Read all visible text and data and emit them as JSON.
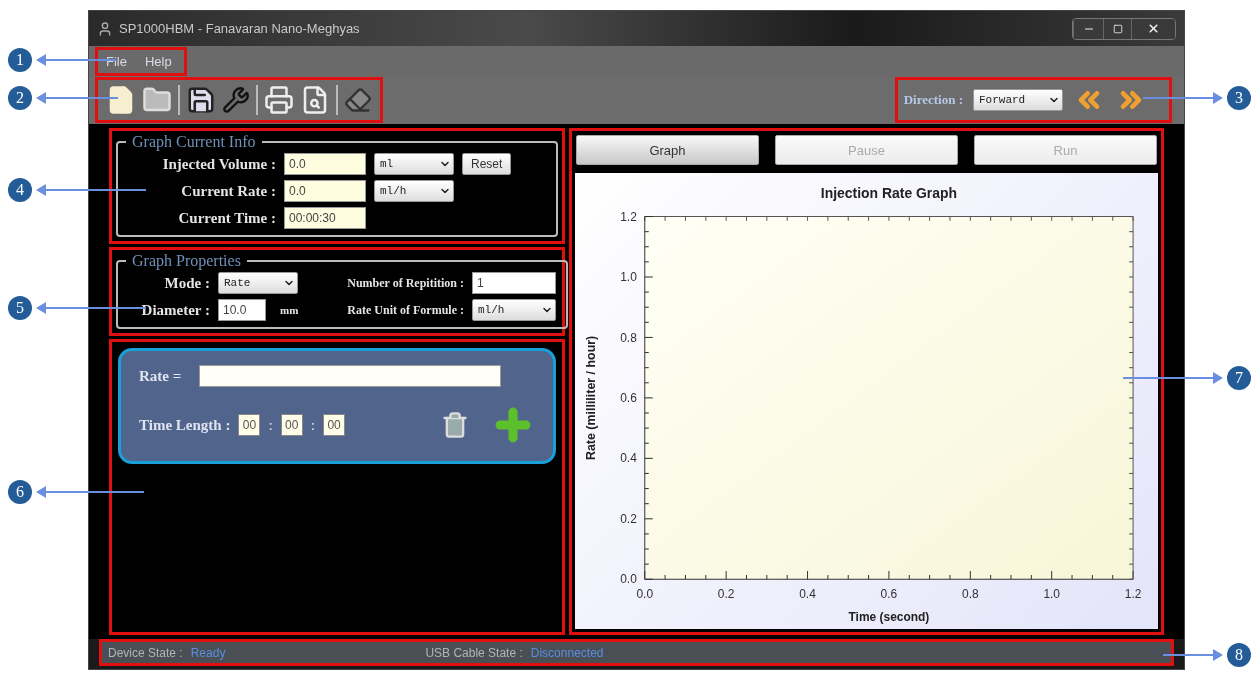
{
  "window": {
    "title": "SP1000HBM - Fanavaran Nano-Meghyas"
  },
  "menu": [
    "File",
    "Help"
  ],
  "toolbar": {
    "direction_label": "Direction :",
    "direction": "Forward"
  },
  "graph_current_info": {
    "title": "Graph Current Info",
    "reset_button": "Reset",
    "fields": [
      {
        "label": "Injected Volume :",
        "value": "0.0",
        "unit": "ml"
      },
      {
        "label": "Current Rate :",
        "value": "0.0",
        "unit": "ml/h"
      },
      {
        "label": "Current Time :",
        "value": "00:00:30"
      }
    ]
  },
  "graph_properties": {
    "title": "Graph Properties",
    "mode_label": "Mode :",
    "mode": "Rate",
    "repetition_label": "Number of Repitition :",
    "repetition": "1",
    "diameter_label": "Diameter :",
    "diameter": "10.0",
    "diameter_unit": "mm",
    "rate_unit_label": "Rate Unit of Formule :",
    "rate_unit": "ml/h"
  },
  "formula": {
    "rate_label": "Rate =",
    "time_label": "Time Length :",
    "time": [
      "00",
      "00",
      "00"
    ],
    "separators": [
      ":",
      ":"
    ]
  },
  "graph_buttons": [
    {
      "label": "Graph",
      "disabled": false
    },
    {
      "label": "Pause",
      "disabled": true
    },
    {
      "label": "Run",
      "disabled": true
    }
  ],
  "chart": {
    "chart_data": {
      "type": "line",
      "title": "Injection Rate Graph",
      "xlabel": "Time (second)",
      "ylabel": "Rate (milliliter / hour)",
      "xlim": [
        0,
        1.2
      ],
      "ylim": [
        0,
        1.2
      ],
      "xticks": [
        {
          "value": 0,
          "label": "0.0"
        },
        {
          "value": 0.2,
          "label": "0.2"
        },
        {
          "value": 0.4,
          "label": "0.4"
        },
        {
          "value": 0.6,
          "label": "0.6"
        },
        {
          "value": 0.8,
          "label": "0.8"
        },
        {
          "value": 1,
          "label": "1.0"
        },
        {
          "value": 1.2,
          "label": "1.2"
        }
      ],
      "yticks": [
        {
          "value": 0,
          "label": "0.0"
        },
        {
          "value": 0.2,
          "label": "0.2"
        },
        {
          "value": 0.4,
          "label": "0.4"
        },
        {
          "value": 0.6,
          "label": "0.6"
        },
        {
          "value": 0.8,
          "label": "0.8"
        },
        {
          "value": 1,
          "label": "1.0"
        },
        {
          "value": 1.2,
          "label": "1.2"
        }
      ]
    }
  },
  "status_bar": {
    "device_label": "Device State :",
    "device": "Ready",
    "usb_label": "USB Cable State :",
    "usb": "Disconnected"
  },
  "callouts": [
    {
      "number": "1"
    },
    {
      "number": "2"
    },
    {
      "number": "3"
    },
    {
      "number": "4"
    },
    {
      "number": "5"
    },
    {
      "number": "7"
    },
    {
      "number": "6"
    },
    {
      "number": "8"
    }
  ]
}
